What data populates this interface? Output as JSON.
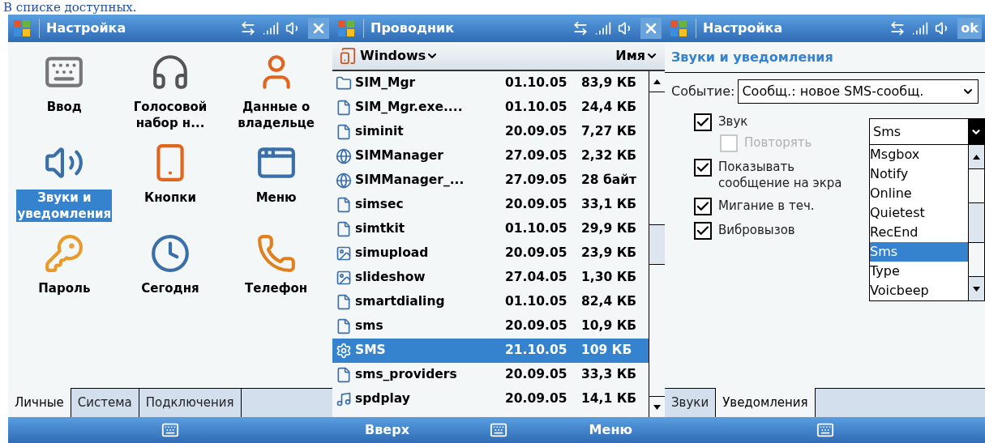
{
  "page_caption": "В списке доступных.",
  "screens": [
    {
      "kind": "grid",
      "title": "Настройка",
      "title_button": {
        "kind": "close"
      },
      "items": [
        {
          "label": "Ввод",
          "selected": false
        },
        {
          "label": "Голосовой набор н...",
          "selected": false
        },
        {
          "label": "Данные о владельце",
          "selected": false
        },
        {
          "label": "Звуки и уведомления",
          "selected": true
        },
        {
          "label": "Кнопки",
          "selected": false
        },
        {
          "label": "Меню",
          "selected": false
        },
        {
          "label": "Пароль",
          "selected": false
        },
        {
          "label": "Сегодня",
          "selected": false
        },
        {
          "label": "Телефон",
          "selected": false
        }
      ],
      "tabs": [
        {
          "label": "Личные",
          "selected": true
        },
        {
          "label": "Система",
          "selected": false
        },
        {
          "label": "Подключения",
          "selected": false
        }
      ]
    },
    {
      "kind": "files",
      "title": "Проводник",
      "title_button": {
        "kind": "close"
      },
      "folder": "Windows",
      "sort": "Имя",
      "rows": [
        {
          "name": "SIM_Mgr",
          "date": "01.10.05",
          "size": "83,9 КБ",
          "selected": false
        },
        {
          "name": "SIM_Mgr.exe....",
          "date": "01.10.05",
          "size": "24,4 КБ",
          "selected": false
        },
        {
          "name": "siminit",
          "date": "20.09.05",
          "size": "7,27 КБ",
          "selected": false
        },
        {
          "name": "SIMManager",
          "date": "27.09.05",
          "size": "2,32 КБ",
          "selected": false
        },
        {
          "name": "SIMManager_...",
          "date": "27.09.05",
          "size": "28 байт",
          "selected": false
        },
        {
          "name": "simsec",
          "date": "20.09.05",
          "size": "33,1 КБ",
          "selected": false
        },
        {
          "name": "simtkit",
          "date": "01.10.05",
          "size": "29,9 КБ",
          "selected": false
        },
        {
          "name": "simupload",
          "date": "20.09.05",
          "size": "23,9 КБ",
          "selected": false
        },
        {
          "name": "slideshow",
          "date": "27.04.05",
          "size": "1,30 КБ",
          "selected": false
        },
        {
          "name": "smartdialing",
          "date": "01.10.05",
          "size": "82,4 КБ",
          "selected": false
        },
        {
          "name": "sms",
          "date": "20.09.05",
          "size": "10,9 КБ",
          "selected": false
        },
        {
          "name": "SMS",
          "date": "21.10.05",
          "size": "109 КБ",
          "selected": true
        },
        {
          "name": "sms_providers",
          "date": "20.09.05",
          "size": "33,3 КБ",
          "selected": false
        },
        {
          "name": "spdplay",
          "date": "20.09.05",
          "size": "14,1 КБ",
          "selected": false
        }
      ],
      "softkeys": [
        "Вверх",
        "Меню"
      ]
    },
    {
      "kind": "notifications",
      "title": "Настройка",
      "title_button": {
        "kind": "text",
        "label": "ok"
      },
      "section_title": "Звуки и уведомления",
      "event_label": "Событие:",
      "event_value": "Сообщ.: новое SMS-сообщ.",
      "options": [
        {
          "label": "Звук",
          "checked": true,
          "disabled": false,
          "children": [
            {
              "label": "Повторять",
              "checked": false,
              "disabled": true
            }
          ]
        },
        {
          "label": "Показывать сообщение на экра",
          "checked": true,
          "disabled": false
        },
        {
          "label": "Мигание в теч.",
          "checked": true,
          "disabled": false
        },
        {
          "label": "Вибровызов",
          "checked": true,
          "disabled": false
        }
      ],
      "sound_value": "Sms",
      "sound_list": [
        {
          "label": "Msgbox",
          "selected": false
        },
        {
          "label": "Notify",
          "selected": false
        },
        {
          "label": "Online",
          "selected": false
        },
        {
          "label": "Quietest",
          "selected": false
        },
        {
          "label": "RecEnd",
          "selected": false
        },
        {
          "label": "Sms",
          "selected": true
        },
        {
          "label": "Type",
          "selected": false
        },
        {
          "label": "Voicbeep",
          "selected": false
        }
      ],
      "tabs": [
        {
          "label": "Звуки",
          "selected": false
        },
        {
          "label": "Уведомления",
          "selected": true
        }
      ]
    }
  ]
}
